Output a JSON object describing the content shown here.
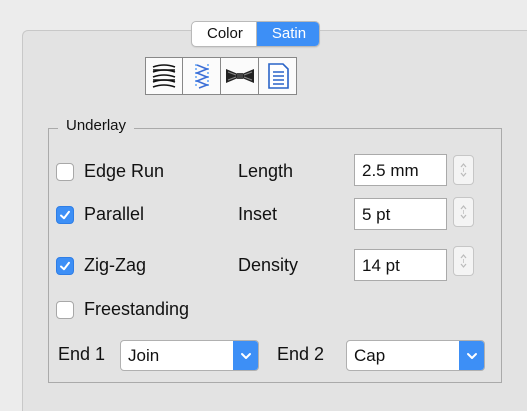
{
  "tabs": [
    {
      "label": "Color",
      "selected": false
    },
    {
      "label": "Satin",
      "selected": true
    }
  ],
  "toolbar": {
    "icons": [
      "satin-stitch-icon",
      "zigzag-underlay-icon",
      "bowtie-shape-icon",
      "document-lines-icon"
    ],
    "selected_index": 1
  },
  "underlay": {
    "title": "Underlay",
    "options": [
      {
        "label": "Edge Run",
        "checked": false
      },
      {
        "label": "Parallel",
        "checked": true
      },
      {
        "label": "Zig-Zag",
        "checked": true
      },
      {
        "label": "Freestanding",
        "checked": false
      }
    ],
    "fields": [
      {
        "label": "Length",
        "value": "2.5 mm"
      },
      {
        "label": "Inset",
        "value": "5 pt"
      },
      {
        "label": "Density",
        "value": "14 pt"
      }
    ],
    "end1": {
      "label": "End 1",
      "value": "Join"
    },
    "end2": {
      "label": "End 2",
      "value": "Cap"
    }
  },
  "colors": {
    "accent": "#3d8ff6",
    "panel": "#e3e3e3"
  }
}
